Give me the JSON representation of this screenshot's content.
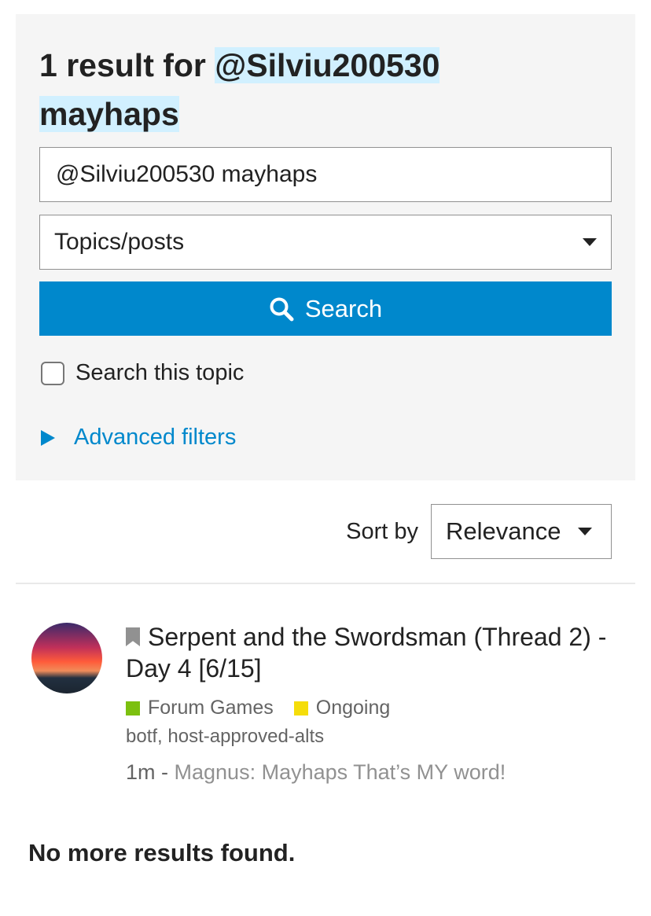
{
  "heading": {
    "prefix": "1 result for ",
    "query_line1": "@Silviu200530",
    "query_line2": "mayhaps"
  },
  "search": {
    "query_value": "@Silviu200530 mayhaps",
    "type_selected": "Topics/posts",
    "button_label": "Search",
    "search_this_topic_label": "Search this topic",
    "search_this_topic_checked": false,
    "advanced_filters_label": "Advanced filters"
  },
  "sort": {
    "label": "Sort by",
    "selected": "Relevance"
  },
  "results": [
    {
      "title": "Serpent and the Swordsman (Thread 2) - Day 4 [6/15]",
      "categories": [
        {
          "name": "Forum Games",
          "color": "#7cc00f"
        },
        {
          "name": "Ongoing",
          "color": "#f5dd0a"
        }
      ],
      "tags": "botf, host-approved-alts",
      "age": "1m",
      "separator": " - ",
      "blurb": "Magnus: Mayhaps That’s MY word!"
    }
  ],
  "footer": {
    "no_more": "No more results found."
  },
  "colors": {
    "accent": "#0088cc",
    "highlight": "#d1f0ff",
    "panel": "#f5f5f5"
  },
  "icons": {
    "search_button": "search-icon",
    "type_dropdown": "caret-down-icon",
    "sort_dropdown": "caret-down-icon",
    "advanced_toggle": "triangle-right-icon",
    "topic_status": "bookmark-icon"
  }
}
